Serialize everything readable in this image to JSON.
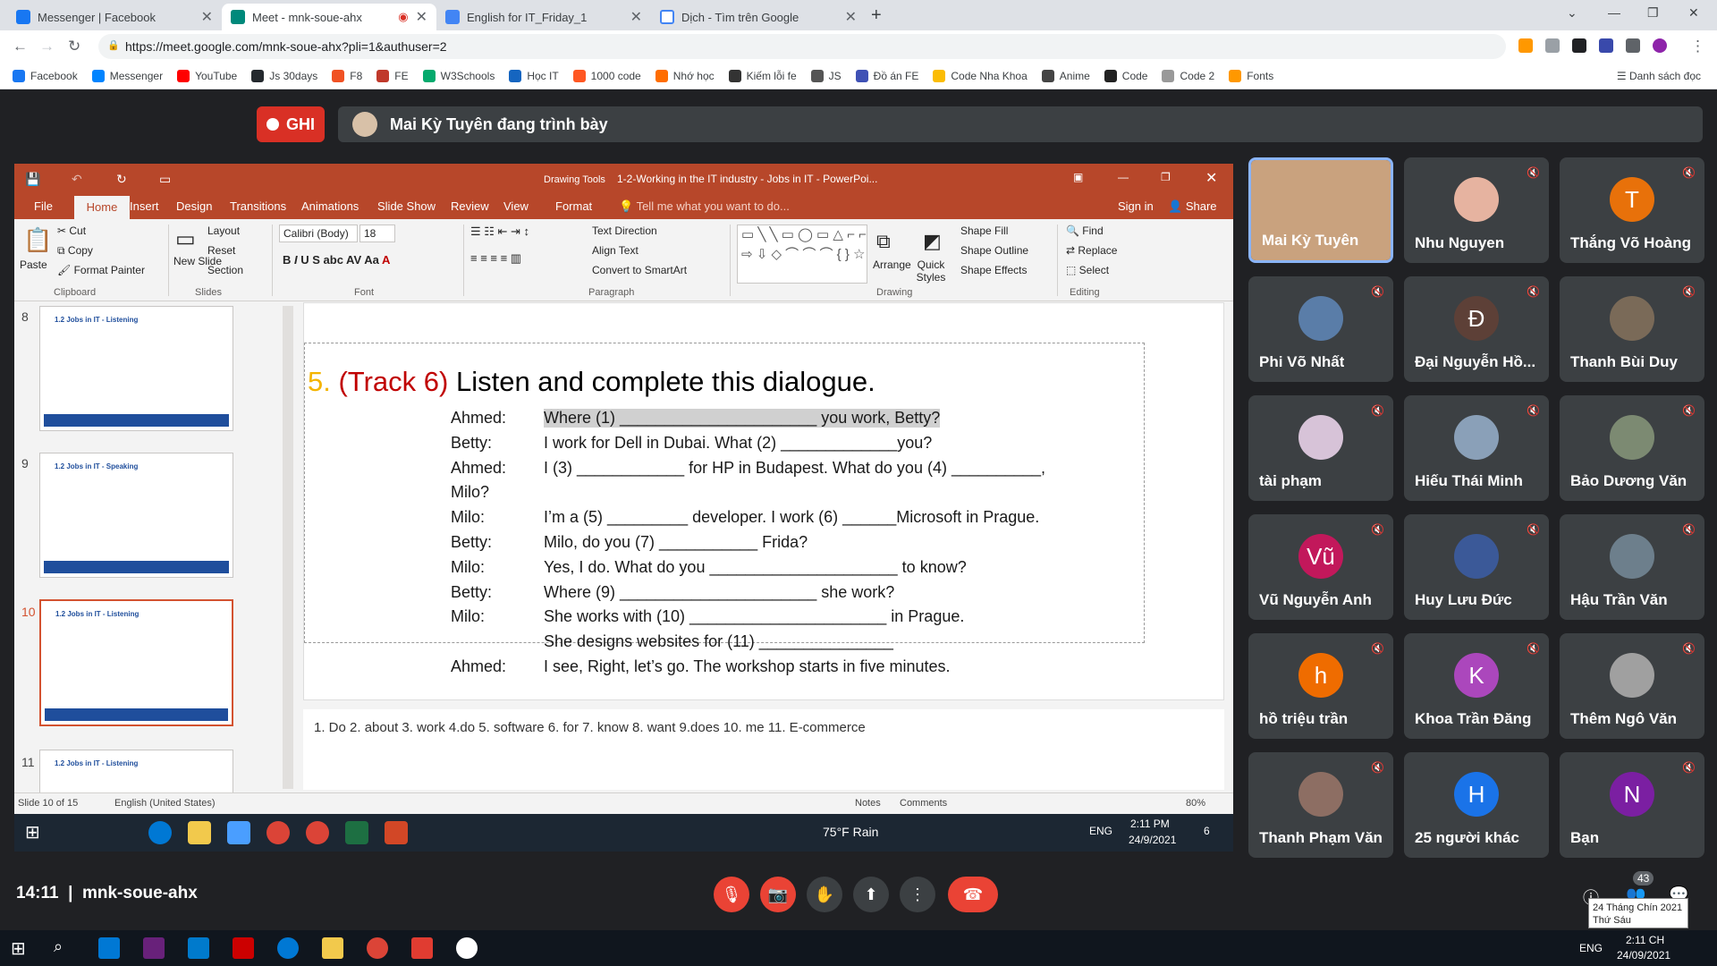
{
  "browser": {
    "tabs": [
      {
        "title": "Messenger | Facebook",
        "color": "#1877f2"
      },
      {
        "title": "Meet - mnk-soue-ahx",
        "color": "#00897b"
      },
      {
        "title": "English for IT_Friday_1",
        "color": "#4285f4"
      },
      {
        "title": "Dịch - Tìm trên Google",
        "color": "#ffffff"
      }
    ],
    "url": "https://meet.google.com/mnk-soue-ahx?pli=1&authuser=2",
    "bookmarks": [
      {
        "label": "Facebook",
        "color": "#1877f2"
      },
      {
        "label": "Messenger",
        "color": "#0084ff"
      },
      {
        "label": "YouTube",
        "color": "#ff0000"
      },
      {
        "label": "Js 30days",
        "color": "#24292e"
      },
      {
        "label": "F8",
        "color": "#f05123"
      },
      {
        "label": "FE",
        "color": "#c0392b"
      },
      {
        "label": "W3Schools",
        "color": "#04aa6d"
      },
      {
        "label": "Học IT",
        "color": "#1565c0"
      },
      {
        "label": "1000 code",
        "color": "#ff5722"
      },
      {
        "label": "Nhớ học",
        "color": "#ff6d00"
      },
      {
        "label": "Kiếm lỗi fe",
        "color": "#333"
      },
      {
        "label": "JS",
        "color": "#555"
      },
      {
        "label": "Đồ án FE",
        "color": "#3f51b5"
      },
      {
        "label": "Code Nha Khoa",
        "color": "#fbbc04"
      },
      {
        "label": "Anime",
        "color": "#444"
      },
      {
        "label": "Code",
        "color": "#222"
      },
      {
        "label": "Code 2",
        "color": "#999"
      },
      {
        "label": "Fonts",
        "color": "#ff9800"
      }
    ],
    "reading_list": "Danh sách đọc"
  },
  "meet": {
    "rec_label": "GHI",
    "presenter_text": "Mai Kỳ Tuyên đang trình bày",
    "time": "14:11",
    "meeting_code": "mnk-soue-ahx",
    "participants_count": "43",
    "participants": [
      {
        "name": "Mai Kỳ Tuyên",
        "initial": "",
        "color": "#c9a27e",
        "speaking": true
      },
      {
        "name": "Nhu Nguyen",
        "initial": "",
        "color": "#e6b3a0"
      },
      {
        "name": "Thắng Võ Hoàng",
        "initial": "T",
        "color": "#e8710a"
      },
      {
        "name": "Phi Võ Nhất",
        "initial": "",
        "color": "#5a7da8"
      },
      {
        "name": "Đại Nguyễn Hồ...",
        "initial": "Đ",
        "color": "#5d4037"
      },
      {
        "name": "Thanh Bùi Duy",
        "initial": "",
        "color": "#7a6a58"
      },
      {
        "name": "tài phạm",
        "initial": "",
        "color": "#d7c3d8"
      },
      {
        "name": "Hiếu Thái Minh",
        "initial": "",
        "color": "#8aa0b8"
      },
      {
        "name": "Bảo Dương Văn",
        "initial": "",
        "color": "#7c8a72"
      },
      {
        "name": "Vũ Nguyễn Anh",
        "initial": "Vũ",
        "color": "#c2185b"
      },
      {
        "name": "Huy Lưu Đức",
        "initial": "",
        "color": "#3b5998"
      },
      {
        "name": "Hậu Trần Văn",
        "initial": "",
        "color": "#6d7f8c"
      },
      {
        "name": "hồ triệu trần",
        "initial": "h",
        "color": "#ef6c00"
      },
      {
        "name": "Khoa Trần Đăng",
        "initial": "K",
        "color": "#ab47bc"
      },
      {
        "name": "Thêm Ngô Văn",
        "initial": "",
        "color": "#a0a0a0"
      },
      {
        "name": "Thanh Phạm Văn",
        "initial": "",
        "color": "#8d6e63"
      },
      {
        "name": "25 người khác",
        "initial": "H",
        "color": "#1a73e8"
      },
      {
        "name": "Bạn",
        "initial": "N",
        "color": "#7b1fa2"
      }
    ]
  },
  "ppt": {
    "quick_title": "Drawing Tools",
    "doc_title": "1-2-Working in the IT industry - Jobs in IT - PowerPoi...",
    "tabs": [
      "File",
      "Home",
      "Insert",
      "Design",
      "Transitions",
      "Animations",
      "Slide Show",
      "Review",
      "View",
      "Format"
    ],
    "tell_me": "Tell me what you want to do...",
    "sign_in": "Sign in",
    "share": "Share",
    "ribbon": {
      "paste": "Paste",
      "cut": "Cut",
      "copy": "Copy",
      "format_painter": "Format Painter",
      "clipboard": "Clipboard",
      "new_slide": "New Slide",
      "layout": "Layout",
      "reset": "Reset",
      "section": "Section",
      "slides": "Slides",
      "font_name": "Calibri (Body)",
      "font_size": "18",
      "font": "Font",
      "text_direction": "Text Direction",
      "align_text": "Align Text",
      "convert_smartart": "Convert to SmartArt",
      "paragraph": "Paragraph",
      "arrange": "Arrange",
      "quick_styles": "Quick Styles",
      "shape_fill": "Shape Fill",
      "shape_outline": "Shape Outline",
      "shape_effects": "Shape Effects",
      "drawing": "Drawing",
      "find": "Find",
      "replace": "Replace",
      "select": "Select",
      "editing": "Editing"
    },
    "thumbs": [
      {
        "num": "8",
        "title": "1.2 Jobs in IT - Listening"
      },
      {
        "num": "9",
        "title": "1.2 Jobs in IT - Speaking"
      },
      {
        "num": "10",
        "title": "1.2 Jobs in IT - Listening"
      },
      {
        "num": "11",
        "title": "1.2 Jobs in IT - Listening"
      }
    ],
    "slide": {
      "num": "5.",
      "track": "(Track 6)",
      "title": "Listen and complete this dialogue.",
      "lines": [
        {
          "speaker": "Ahmed:",
          "text": "Where (1) ______________________ you work, Betty?"
        },
        {
          "speaker": "Betty:",
          "text": "I work for Dell in Dubai. What (2) _____________you?"
        },
        {
          "speaker": "Ahmed:",
          "text": "I (3) ____________ for HP in Budapest. What do you (4) __________,"
        },
        {
          "speaker": "Milo?",
          "text": ""
        },
        {
          "speaker": "Milo:",
          "text": "I’m a (5) _________ developer. I work (6) ______Microsoft in Prague."
        },
        {
          "speaker": "Betty:",
          "text": "Milo, do you (7) ___________ Frida?"
        },
        {
          "speaker": "Milo:",
          "text": "Yes, I do. What do you _____________________ to know?"
        },
        {
          "speaker": "Betty:",
          "text": "Where (9) ______________________ she work?"
        },
        {
          "speaker": "Milo:",
          "text": " She works with (10) ______________________ in Prague."
        },
        {
          "speaker": "",
          "text": "She designs websites for (11) _______________"
        },
        {
          "speaker": "Ahmed:",
          "text": "I see, Right, let’s go. The workshop starts in five minutes."
        }
      ]
    },
    "notes": "1. Do   2. about  3. work  4.do  5. software  6. for 7. know  8. want    9.does  10. me 11. E-commerce",
    "status": {
      "slide": "Slide 10 of 15",
      "language": "English (United States)",
      "notes": "Notes",
      "comments": "Comments",
      "zoom": "80%"
    }
  },
  "inner_taskbar": {
    "weather": "75°F  Rain",
    "lang": "ENG",
    "time": "2:11 PM",
    "date": "24/9/2021",
    "notif": "6"
  },
  "windows": {
    "lang": "ENG",
    "time": "2:11 CH",
    "date": "24/09/2021",
    "notif_date": "24 Tháng Chín 2021",
    "notif_day": "Thứ Sáu"
  }
}
